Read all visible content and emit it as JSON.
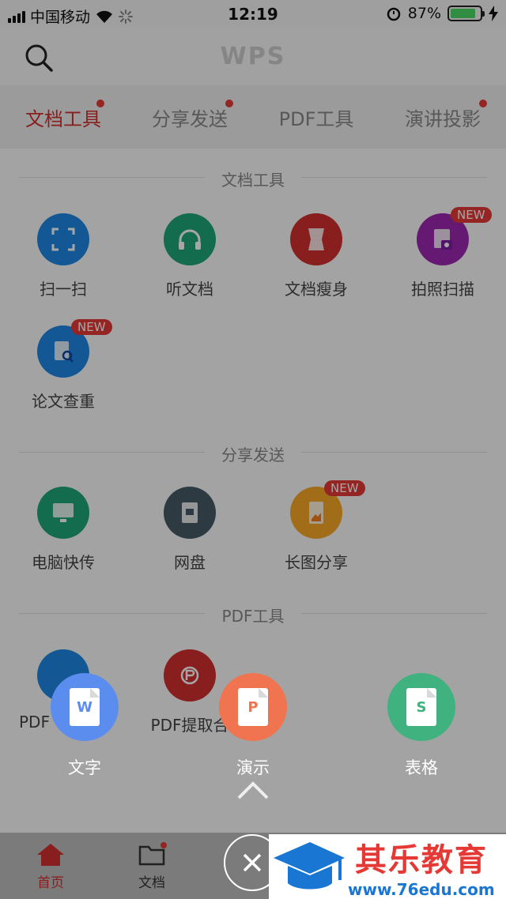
{
  "status_bar": {
    "carrier": "中国移动",
    "time": "12:19",
    "battery": "87%",
    "battery_level": 0.87
  },
  "header": {
    "logo": "WPS"
  },
  "tabs": [
    {
      "label": "文档工具",
      "active": true,
      "dot": true
    },
    {
      "label": "分享发送",
      "active": false,
      "dot": true
    },
    {
      "label": "PDF工具",
      "active": false,
      "dot": false
    },
    {
      "label": "演讲投影",
      "active": false,
      "dot": true
    }
  ],
  "sections": {
    "doc_tools": {
      "title": "文档工具",
      "items": [
        {
          "label": "扫一扫",
          "icon": "scan-icon",
          "color": "#1e88e5"
        },
        {
          "label": "听文档",
          "icon": "headphones-icon",
          "color": "#1fa67a"
        },
        {
          "label": "文档瘦身",
          "icon": "slim-doc-icon",
          "color": "#d32f2f"
        },
        {
          "label": "拍照扫描",
          "icon": "photo-scan-icon",
          "color": "#9c27b0",
          "badge": "NEW"
        },
        {
          "label": "论文查重",
          "icon": "paper-check-icon",
          "color": "#1e88e5",
          "badge": "NEW"
        }
      ]
    },
    "share": {
      "title": "分享发送",
      "items": [
        {
          "label": "电脑快传",
          "icon": "pc-transfer-icon",
          "color": "#1fa67a"
        },
        {
          "label": "网盘",
          "icon": "cloud-disk-icon",
          "color": "#455a64"
        },
        {
          "label": "长图分享",
          "icon": "long-image-icon",
          "color": "#f9a825",
          "badge": "NEW"
        }
      ]
    },
    "pdf": {
      "title": "PDF工具",
      "items": [
        {
          "label": "PDF",
          "icon": "pdf-icon",
          "color": "#1e88e5"
        },
        {
          "label": "PDF提取合",
          "icon": "pdf-extract-icon",
          "color": "#d32f2f"
        }
      ]
    }
  },
  "create": [
    {
      "label": "文字",
      "letter": "W",
      "color": "#5b8def",
      "glyph_color": "#5b8def"
    },
    {
      "label": "演示",
      "letter": "P",
      "color": "#f0744f",
      "glyph_color": "#f0744f"
    },
    {
      "label": "表格",
      "letter": "S",
      "color": "#3fb27f",
      "glyph_color": "#3fb27f"
    }
  ],
  "bottom_nav": [
    {
      "label": "首页",
      "active": true
    },
    {
      "label": "文档",
      "active": false
    }
  ],
  "watermark": {
    "brand": "其乐教育",
    "url": "www.76edu.com"
  }
}
